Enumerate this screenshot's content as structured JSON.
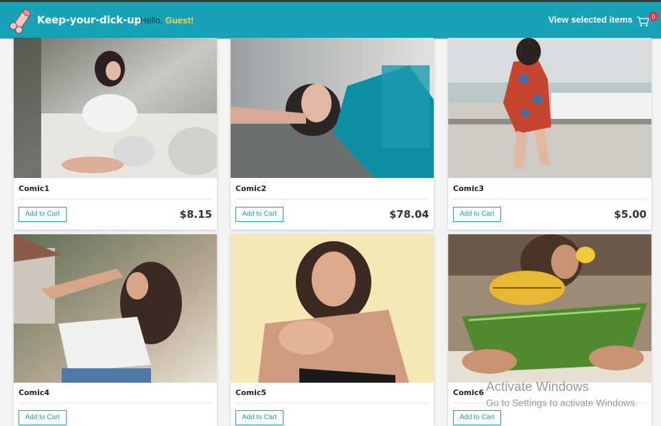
{
  "header": {
    "brand": "Keep-your-dick-up",
    "greeting": "Hello,",
    "user": "Guest!",
    "view_selected": "View selected items",
    "cart_count": "0"
  },
  "products": [
    {
      "title": "Comic1",
      "button": "Add to Cart",
      "price": "$8.15"
    },
    {
      "title": "Comic2",
      "button": "Add to Cart",
      "price": "$78.04"
    },
    {
      "title": "Comic3",
      "button": "Add to Cart",
      "price": "$5.00"
    },
    {
      "title": "Comic4",
      "button": "Add to Cart",
      "price": ""
    },
    {
      "title": "Comic5",
      "button": "Add to Cart",
      "price": ""
    },
    {
      "title": "Comic6",
      "button": "Add to Cart",
      "price": ""
    }
  ],
  "watermark": {
    "line1": "Activate Windows",
    "line2": "Go to Settings to activate Windows."
  },
  "colors": {
    "navbar": "#17a2b8",
    "accent": "#17a2b8",
    "badge": "#dc3545",
    "user": "#ffd43b"
  }
}
